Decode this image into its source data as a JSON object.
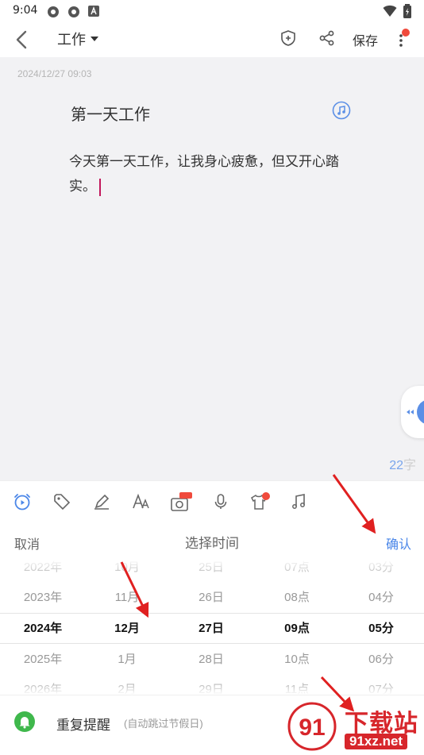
{
  "status_bar": {
    "time": "9:04"
  },
  "header": {
    "folder_label": "工作",
    "save_label": "保存",
    "more_badge_color": "#f04a3c"
  },
  "note": {
    "date": "2024/12/27 09:03",
    "title": "第一天工作",
    "body": "今天第一天工作，让我身心疲惫，但又开心踏实。",
    "word_count": "22",
    "word_unit": "字"
  },
  "toolbar": {
    "icons": [
      "alarm-icon",
      "tag-icon",
      "pen-icon",
      "font-icon",
      "camera-ocr-icon",
      "microphone-icon",
      "shirt-vip-icon",
      "music-icon"
    ],
    "ocr_badge": "OCR",
    "vip_badge": "V"
  },
  "time_picker": {
    "cancel_label": "取消",
    "title": "选择时间",
    "confirm_label": "确认",
    "accent_color": "#4a86e8",
    "columns": {
      "year": [
        "2022年",
        "2023年",
        "2024年",
        "2025年",
        "2026年"
      ],
      "month": [
        "10月",
        "11月",
        "12月",
        "1月",
        "2月"
      ],
      "day": [
        "25日",
        "26日",
        "27日",
        "28日",
        "29日"
      ],
      "hour": [
        "07点",
        "08点",
        "09点",
        "10点",
        "11点"
      ],
      "minute": [
        "03分",
        "04分",
        "05分",
        "06分",
        "07分"
      ]
    },
    "selected": {
      "year": "2024年",
      "month": "12月",
      "day": "27日",
      "hour": "09点",
      "minute": "05分"
    }
  },
  "repeat": {
    "label": "重复提醒",
    "sublabel": "(自动跳过节假日)",
    "icon": "bell-icon",
    "icon_color": "#3fb84c"
  },
  "watermark": {
    "text": "下载站",
    "url": "91xz.net"
  }
}
